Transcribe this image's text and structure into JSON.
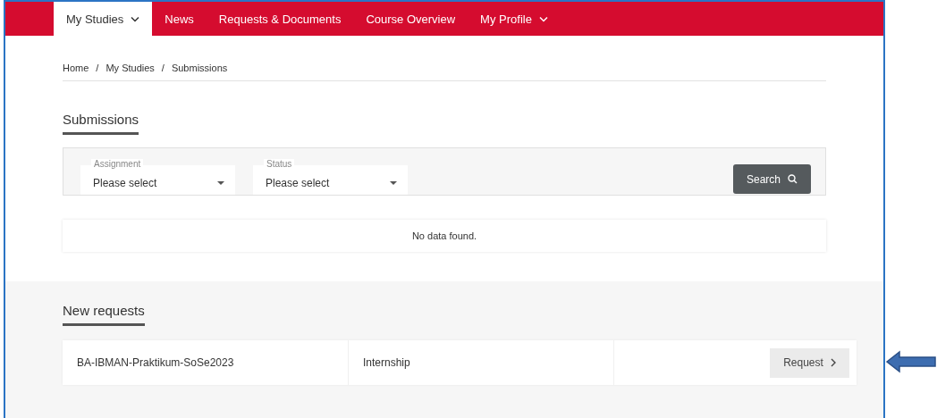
{
  "nav": {
    "items": [
      {
        "label": "My Studies",
        "selected": true,
        "dropdown": true
      },
      {
        "label": "News",
        "selected": false,
        "dropdown": false
      },
      {
        "label": "Requests & Documents",
        "selected": false,
        "dropdown": false
      },
      {
        "label": "Course Overview",
        "selected": false,
        "dropdown": false
      },
      {
        "label": "My Profile",
        "selected": false,
        "dropdown": true
      }
    ]
  },
  "breadcrumb": [
    "Home",
    "My Studies",
    "Submissions"
  ],
  "breadcrumb_separator": "/",
  "submissions": {
    "heading": "Submissions",
    "filters": [
      {
        "label": "Assignment",
        "value": "Please select"
      },
      {
        "label": "Status",
        "value": "Please select"
      }
    ],
    "search_button": "Search",
    "empty_message": "No data found."
  },
  "new_requests": {
    "heading": "New requests",
    "rows": [
      {
        "name": "BA-IBMAN-Praktikum-SoSe2023",
        "type": "Internship",
        "button": "Request"
      }
    ]
  }
}
